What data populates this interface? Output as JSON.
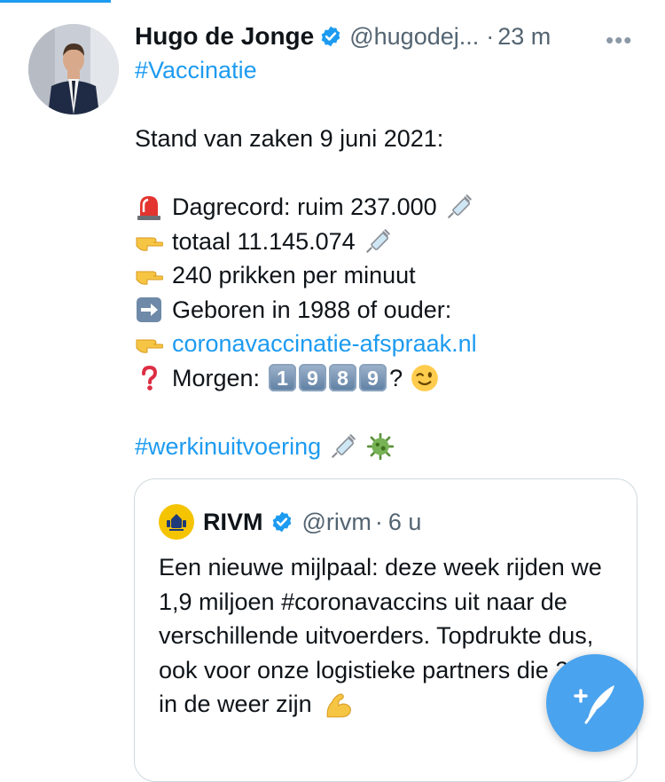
{
  "tweet": {
    "author_name": "Hugo de Jonge",
    "author_handle": "@hugodej...",
    "separator": "·",
    "time": "23 m",
    "more_label": "•••",
    "hashtag_line": "#Vaccinatie",
    "lines": [
      "Stand van zaken 9 juni 2021:",
      "Dagrecord: ruim 237.000",
      "totaal 11.145.074",
      "240 prikken per minuut",
      "Geboren in 1988 of ouder:",
      "coronavaccinatie-afspraak.nl",
      "Morgen:",
      "?"
    ],
    "keycaps": [
      "1",
      "9",
      "8",
      "9"
    ],
    "closing_hashtag": "#werkinuitvoering"
  },
  "quoted": {
    "author_name": "RIVM",
    "author_handle": "@rivm",
    "separator": "·",
    "time": "6 u",
    "text": "Een nieuwe mijlpaal: deze week rijden we 1,9 miljoen #coronavaccins uit naar de verschillende uitvoerders. Topdrukte dus, ook voor onze logistieke partners die 24/7 in de weer zijn"
  },
  "colors": {
    "link": "#1d9bf0",
    "verified": "#1d9bf0",
    "fab": "#4aa3ee",
    "secondary_text": "#536471"
  },
  "icons": {
    "verified": "verified-badge-icon",
    "alarm": "rotating-light-icon",
    "point": "backhand-index-pointing-right-icon",
    "arrow": "right-arrow-icon",
    "question": "red-question-mark-icon",
    "syringe": "syringe-icon",
    "wink": "winking-face-icon",
    "virus": "microbe-icon",
    "flex": "flexed-biceps-icon",
    "compose": "compose-tweet-icon"
  }
}
